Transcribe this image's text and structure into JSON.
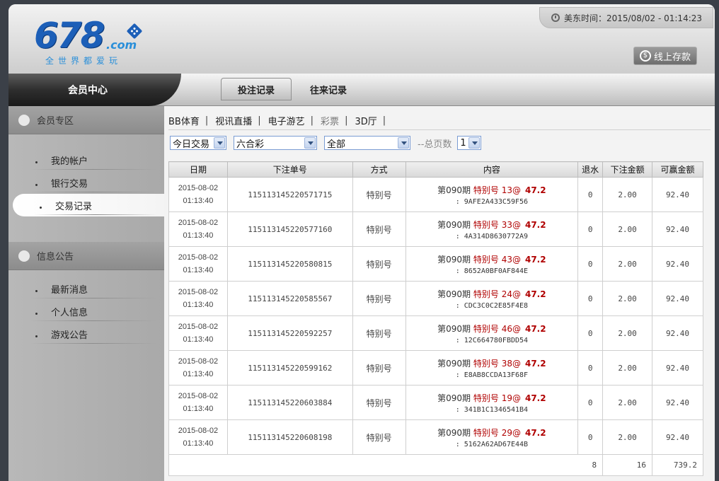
{
  "header": {
    "logo_number": "678",
    "logo_suffix": ".com",
    "logo_tagline": "全世界都爱玩",
    "clock": "美东时间：2015/08/02 - 01:14:23",
    "deposit_label": "线上存款"
  },
  "nav": {
    "member_center": "会员中心",
    "tabs": [
      {
        "label": "投注记录"
      },
      {
        "label": "往来记录"
      }
    ]
  },
  "sidebar": {
    "sections": [
      {
        "title": "会员专区",
        "items": [
          "我的帐户",
          "银行交易",
          "交易记录"
        ]
      },
      {
        "title": "信息公告",
        "items": [
          "最新消息",
          "个人信息",
          "游戏公告"
        ]
      }
    ],
    "active_item": "交易记录"
  },
  "categories": [
    {
      "label": "BB体育"
    },
    {
      "label": "视讯直播"
    },
    {
      "label": "电子游艺"
    },
    {
      "label": "彩票"
    },
    {
      "label": "3D厅"
    }
  ],
  "filters": {
    "period": "今日交易",
    "game": "六合彩",
    "scope": "全部",
    "pages_label": "--总页数",
    "page": "1"
  },
  "table": {
    "columns": [
      "日期",
      "下注单号",
      "方式",
      "内容",
      "退水",
      "下注金额",
      "可赢金额"
    ],
    "rows": [
      {
        "date": "2015-08-02",
        "time": "01:13:40",
        "id": "115113145220571715",
        "method": "特别号",
        "period": "第090期",
        "bet": "特别号 13@",
        "odds": "47.2",
        "code": ": 9AFE2A433C59F56",
        "rebate": "0",
        "amount": "2.00",
        "win": "92.40"
      },
      {
        "date": "2015-08-02",
        "time": "01:13:40",
        "id": "115113145220577160",
        "method": "特别号",
        "period": "第090期",
        "bet": "特别号 33@",
        "odds": "47.2",
        "code": ": 4A314D8630772A9",
        "rebate": "0",
        "amount": "2.00",
        "win": "92.40"
      },
      {
        "date": "2015-08-02",
        "time": "01:13:40",
        "id": "115113145220580815",
        "method": "特别号",
        "period": "第090期",
        "bet": "特别号 43@",
        "odds": "47.2",
        "code": ": 8652A0BF0AF844E",
        "rebate": "0",
        "amount": "2.00",
        "win": "92.40"
      },
      {
        "date": "2015-08-02",
        "time": "01:13:40",
        "id": "115113145220585567",
        "method": "特别号",
        "period": "第090期",
        "bet": "特别号 24@",
        "odds": "47.2",
        "code": ": CDC3C0C2E85F4E8",
        "rebate": "0",
        "amount": "2.00",
        "win": "92.40"
      },
      {
        "date": "2015-08-02",
        "time": "01:13:40",
        "id": "115113145220592257",
        "method": "特别号",
        "period": "第090期",
        "bet": "特别号 46@",
        "odds": "47.2",
        "code": ": 12C664780FBDD54",
        "rebate": "0",
        "amount": "2.00",
        "win": "92.40"
      },
      {
        "date": "2015-08-02",
        "time": "01:13:40",
        "id": "115113145220599162",
        "method": "特别号",
        "period": "第090期",
        "bet": "特别号 38@",
        "odds": "47.2",
        "code": ": E8AB8CCDA13F68F",
        "rebate": "0",
        "amount": "2.00",
        "win": "92.40"
      },
      {
        "date": "2015-08-02",
        "time": "01:13:40",
        "id": "115113145220603884",
        "method": "特别号",
        "period": "第090期",
        "bet": "特别号 19@",
        "odds": "47.2",
        "code": ": 341B1C1346541B4",
        "rebate": "0",
        "amount": "2.00",
        "win": "92.40"
      },
      {
        "date": "2015-08-02",
        "time": "01:13:40",
        "id": "115113145220608198",
        "method": "特别号",
        "period": "第090期",
        "bet": "特别号 29@",
        "odds": "47.2",
        "code": ": 5162A62AD67E44B",
        "rebate": "0",
        "amount": "2.00",
        "win": "92.40"
      }
    ],
    "totals": {
      "count": "8",
      "amount": "16",
      "win": "739.2"
    }
  }
}
